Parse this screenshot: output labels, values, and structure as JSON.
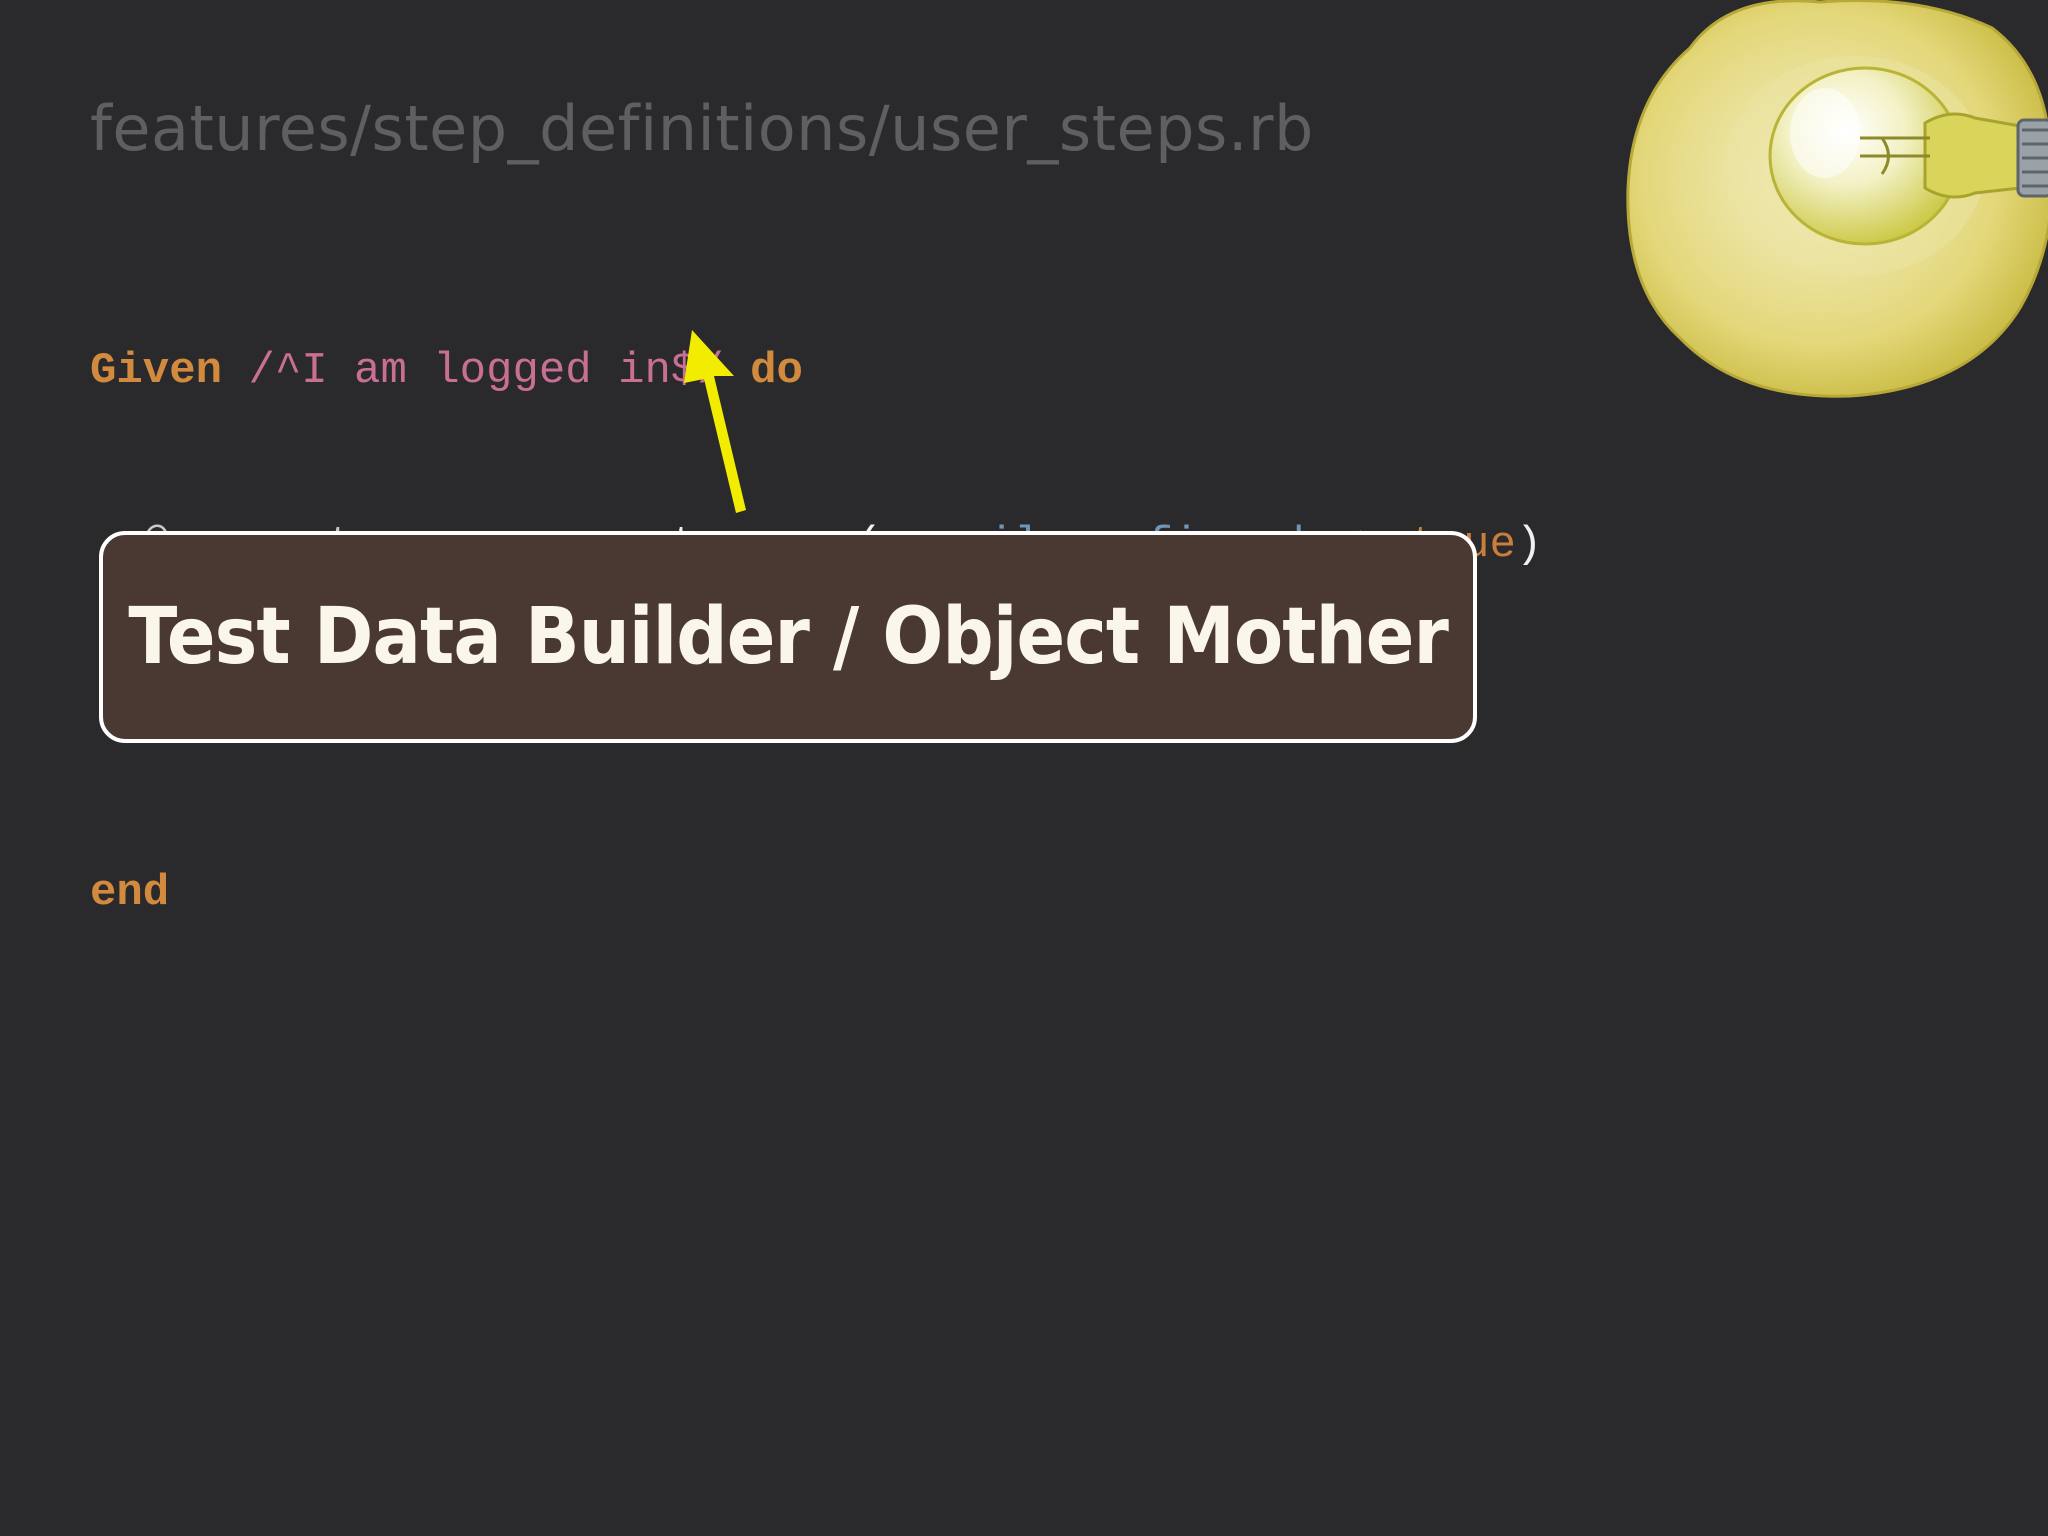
{
  "slide": {
    "file_path": "features/step_definitions/user_steps.rb",
    "code": {
      "line1": {
        "keyword_given": "Given",
        "regex": "/^I am logged in$/",
        "keyword_do": "do"
      },
      "line2": {
        "variable": "@current_user",
        "assign": " = ",
        "method": "create_user(",
        "symbol": ":email_confirmed",
        "hash_arrow": " => ",
        "boolean": "true",
        "close": ")"
      },
      "line3": {
        "keyword_end": "end"
      }
    },
    "callout": {
      "text": "Test Data Builder / Object Mother"
    },
    "icons": {
      "arrow": "arrow-up-icon",
      "badge": "lightbulb-icon"
    },
    "colors": {
      "background": "#2a2a2c",
      "keyword": "#d28a3e",
      "regex": "#c96f94",
      "symbol": "#6f96b8",
      "arrow": "#f2ec00",
      "callout_fill": "#4a3932",
      "badge": "#e7db7c"
    }
  }
}
